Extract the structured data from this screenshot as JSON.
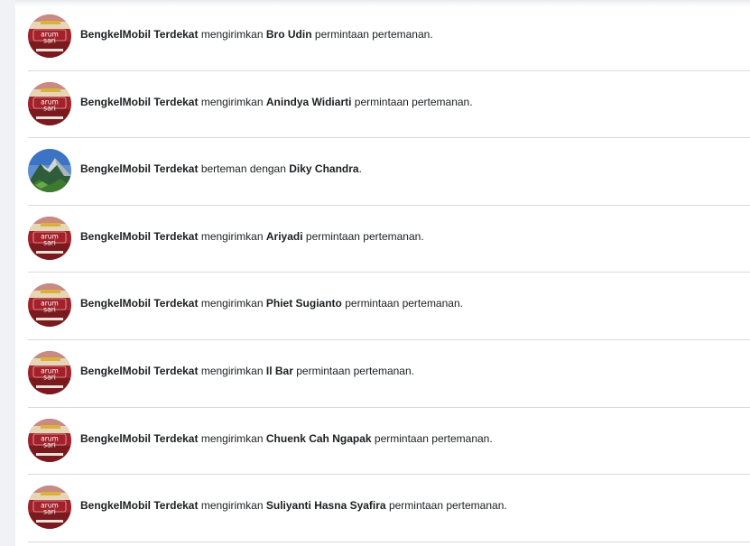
{
  "notifications": [
    {
      "actor": "BengkelMobil Terdekat",
      "verb": "mengirimkan",
      "target": "Bro Udin",
      "tail": "permintaan pertemanan.",
      "avatar_icon": "arumsari-logo-icon"
    },
    {
      "actor": "BengkelMobil Terdekat",
      "verb": "mengirimkan",
      "target": "Anindya Widiarti",
      "tail": "permintaan pertemanan.",
      "avatar_icon": "arumsari-logo-icon"
    },
    {
      "actor": "BengkelMobil Terdekat",
      "verb": "berteman dengan",
      "target": "Diky Chandra",
      "tail": ".",
      "avatar_icon": "mountain-photo-icon"
    },
    {
      "actor": "BengkelMobil Terdekat",
      "verb": "mengirimkan",
      "target": "Ariyadi",
      "tail": "permintaan pertemanan.",
      "avatar_icon": "arumsari-logo-icon"
    },
    {
      "actor": "BengkelMobil Terdekat",
      "verb": "mengirimkan",
      "target": "Phiet Sugianto",
      "tail": "permintaan pertemanan.",
      "avatar_icon": "arumsari-logo-icon"
    },
    {
      "actor": "BengkelMobil Terdekat",
      "verb": "mengirimkan",
      "target": "Il Bar",
      "tail": "permintaan pertemanan.",
      "avatar_icon": "arumsari-logo-icon"
    },
    {
      "actor": "BengkelMobil Terdekat",
      "verb": "mengirimkan",
      "target": "Chuenk Cah Ngapak",
      "tail": "permintaan pertemanan.",
      "avatar_icon": "arumsari-logo-icon"
    },
    {
      "actor": "BengkelMobil Terdekat",
      "verb": "mengirimkan",
      "target": "Suliyanti Hasna Syafira",
      "tail": "permintaan pertemanan.",
      "avatar_icon": "arumsari-logo-icon"
    }
  ],
  "logo": {
    "line1": "arum",
    "line2": "sari"
  },
  "colors": {
    "logo_red": "#a3212a",
    "logo_dark": "#7a1a1f",
    "divider": "#d8dadf",
    "text": "#1c1e21"
  }
}
